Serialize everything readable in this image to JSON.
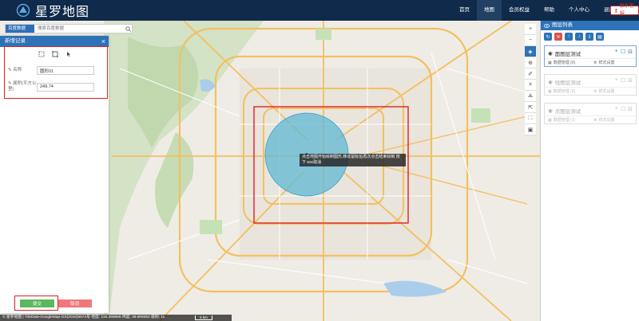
{
  "header": {
    "app_title": "星罗地图",
    "nav": [
      "首页",
      "地图",
      "会员权益",
      "帮助",
      "个人中心",
      "退出"
    ],
    "active_nav": "地图",
    "contact_label": "联系客服"
  },
  "search": {
    "select_label": "百度数据",
    "placeholder": "搜索百度数据"
  },
  "record_panel": {
    "title": "新增记录",
    "fields": [
      {
        "label": "名称",
        "value": "圆形01"
      },
      {
        "label": "面积(平方公里)",
        "value": "249.74"
      }
    ],
    "save_label": "提交",
    "cancel_label": "取消"
  },
  "tooltip_text": "点击地图开始绘制图形,移动鼠标后再次点击结束绘制 按下 esc取消",
  "layers_panel": {
    "title": "图层列表",
    "layers": [
      {
        "name": "面图层测试",
        "data_label": "数据管理 (0)",
        "style_label": "样式设置",
        "active": true
      },
      {
        "name": "线图层测试",
        "data_label": "数据管理 (0)",
        "style_label": "样式设置",
        "active": false
      },
      {
        "name": "点图层测试",
        "data_label": "数据管理 (1)",
        "style_label": "样式设置",
        "active": false
      }
    ]
  },
  "status": {
    "text": "© 星罗地图 | TileData-GoogleMap-GS(2018)5572号  经度: 116.389888  纬度: 39.909252  级别: 11",
    "scale": "5 km"
  },
  "colors": {
    "nav_bg": "#0f2a4a",
    "accent": "#2e72b8",
    "circle_fill": "#5fb8d4",
    "save": "#5cb85c",
    "cancel": "#f0787a",
    "annotation": "#e02020"
  }
}
